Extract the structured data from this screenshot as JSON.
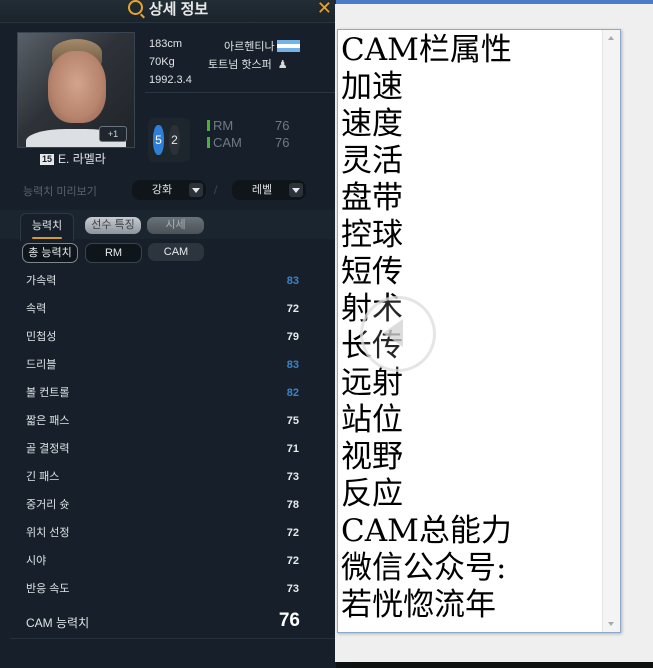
{
  "window": {
    "title": "상세 정보"
  },
  "player": {
    "name": "E. 라멜라",
    "number": "15",
    "upgrade_badge": "+1",
    "height": "183cm",
    "weight": "70Kg",
    "birth_date": "1992.3.4",
    "nation": "아르헨티나",
    "club": "토트넘 핫스퍼",
    "foot_left": "5",
    "foot_right": "2",
    "positions": [
      {
        "name": "RM",
        "rating": "76"
      },
      {
        "name": "CAM",
        "rating": "76"
      }
    ]
  },
  "preview": {
    "label": "능력치 미리보기",
    "enhance_select": "강화",
    "level_select": "레벨",
    "separator": "/"
  },
  "tabs": [
    {
      "label": "능력치",
      "active": true
    },
    {
      "label": "선수 특징",
      "active": false
    },
    {
      "label": "시세",
      "active": false
    }
  ],
  "subtabs": [
    {
      "label": "총 능력치"
    },
    {
      "label": "RM"
    },
    {
      "label": "CAM"
    }
  ],
  "stats": [
    {
      "label": "가속력",
      "value": "83",
      "highlight": true
    },
    {
      "label": "속력",
      "value": "72",
      "highlight": false
    },
    {
      "label": "민첩성",
      "value": "79",
      "highlight": false
    },
    {
      "label": "드리블",
      "value": "83",
      "highlight": true
    },
    {
      "label": "볼 컨트롤",
      "value": "82",
      "highlight": true
    },
    {
      "label": "짧은 패스",
      "value": "75",
      "highlight": false
    },
    {
      "label": "골 결정력",
      "value": "71",
      "highlight": false
    },
    {
      "label": "긴 패스",
      "value": "73",
      "highlight": false
    },
    {
      "label": "중거리 슛",
      "value": "78",
      "highlight": false
    },
    {
      "label": "위치 선정",
      "value": "72",
      "highlight": false
    },
    {
      "label": "시야",
      "value": "72",
      "highlight": false
    },
    {
      "label": "반응 속도",
      "value": "73",
      "highlight": false
    }
  ],
  "total": {
    "label": "CAM 능력치",
    "value": "76"
  },
  "colors": {
    "accent_gold": "#e7a530",
    "highlight_blue": "#3b83c8",
    "position_green": "#4caf3a"
  },
  "notepad": {
    "lines": [
      "CAM栏属性",
      "加速",
      "速度",
      "灵活",
      "盘带",
      "控球",
      "短传",
      "射术",
      "长传",
      "远射",
      "站位",
      "视野",
      "反应",
      "CAM总能力",
      "微信公众号:",
      "若恍惚流年"
    ]
  }
}
